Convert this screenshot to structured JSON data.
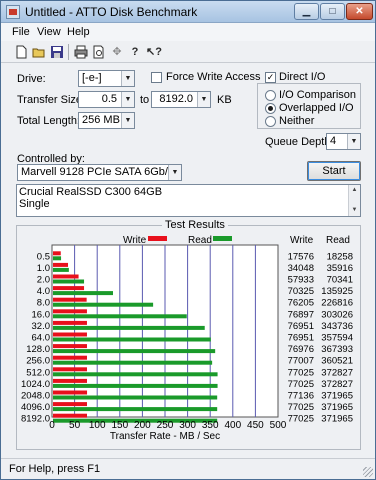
{
  "window": {
    "title": "Untitled - ATTO Disk Benchmark"
  },
  "menus": [
    "File",
    "View",
    "Help"
  ],
  "toolbar": [
    "new-icon",
    "open-icon",
    "save-icon",
    "print-icon",
    "print-preview-icon",
    "move-icon",
    "help-icon",
    "context-help-icon"
  ],
  "settings": {
    "drive_label": "Drive:",
    "drive_value": "[-e-]",
    "force_write_label": "Force Write Access",
    "force_write_checked": false,
    "direct_io_label": "Direct I/O",
    "direct_io_checked": true,
    "transfer_size_label": "Transfer Size:",
    "transfer_from": "0.5",
    "to_label": "to",
    "transfer_to": "8192.0",
    "kb_label": "KB",
    "total_length_label": "Total Length:",
    "total_length_value": "256 MB",
    "io_comparison_label": "I/O Comparison",
    "overlapped_io_label": "Overlapped I/O",
    "neither_label": "Neither",
    "selected_mode": "Overlapped I/O",
    "queue_depth_label": "Queue Depth:",
    "queue_depth_value": "4",
    "controlled_by_label": "Controlled by:",
    "controller_value": "Marvell 9128 PCIe SATA 6Gb/s",
    "start_label": "Start",
    "description_line1": "Crucial RealSSD C300 64GB",
    "description_line2": "Single"
  },
  "chart_data": {
    "type": "bar",
    "title": "Test Results",
    "xlabel": "Transfer Rate - MB / Sec",
    "categories": [
      "0.5",
      "1.0",
      "2.0",
      "4.0",
      "8.0",
      "16.0",
      "32.0",
      "64.0",
      "128.0",
      "256.0",
      "512.0",
      "1024.0",
      "2048.0",
      "4096.0",
      "8192.0"
    ],
    "series": [
      {
        "name": "Write",
        "color": "#e8101c",
        "values": [
          17576,
          34048,
          57933,
          70325,
          76205,
          76897,
          76951,
          76951,
          76976,
          77007,
          77025,
          77025,
          77136,
          77025,
          77025
        ]
      },
      {
        "name": "Read",
        "color": "#1a9a2a",
        "values": [
          18258,
          35916,
          70341,
          135925,
          226816,
          303026,
          343736,
          357594,
          367393,
          360521,
          372827,
          372827,
          371965,
          371965,
          371965
        ]
      }
    ],
    "value_unit": "KB/s",
    "xlim": [
      0,
      500
    ],
    "xticks": [
      "0",
      "50",
      "100",
      "150",
      "200",
      "250",
      "300",
      "350",
      "400",
      "450",
      "500"
    ],
    "column_headers": {
      "write": "Write",
      "read": "Read"
    },
    "legend_write": "Write",
    "legend_read": "Read",
    "grid": true
  },
  "status": {
    "text": "For Help, press F1"
  }
}
